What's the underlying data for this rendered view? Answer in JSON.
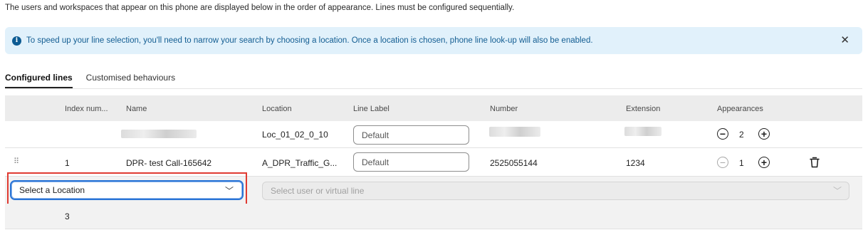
{
  "intro_text": "The users and workspaces that appear on this phone are displayed below in the order of appearance. Lines must be configured sequentially.",
  "banner": {
    "icon": "info-icon",
    "text": "To speed up your line selection, you'll need to narrow your search by choosing a location. Once a location is chosen, phone line look-up will also be enabled.",
    "close_icon": "close-icon"
  },
  "tabs": [
    {
      "label": "Configured lines",
      "active": true
    },
    {
      "label": "Customised behaviours",
      "active": false
    }
  ],
  "table": {
    "columns": {
      "index": "Index num...",
      "name": "Name",
      "location": "Location",
      "line_label": "Line Label",
      "number": "Number",
      "extension": "Extension",
      "appearances": "Appearances"
    },
    "rows": [
      {
        "index": "",
        "name": "",
        "location": "Loc_01_02_0_10",
        "line_label_placeholder": "Default",
        "number": "",
        "extension": "",
        "appearances": "2"
      },
      {
        "index": "1",
        "name": "DPR- test Call-165642",
        "location": "A_DPR_Traffic_G...",
        "line_label_placeholder": "Default",
        "number": "2525055144",
        "extension": "1234",
        "appearances": "1"
      }
    ],
    "new_row": {
      "location_select": "Select a Location",
      "user_select_placeholder": "Select user or virtual line",
      "index": "3"
    }
  }
}
